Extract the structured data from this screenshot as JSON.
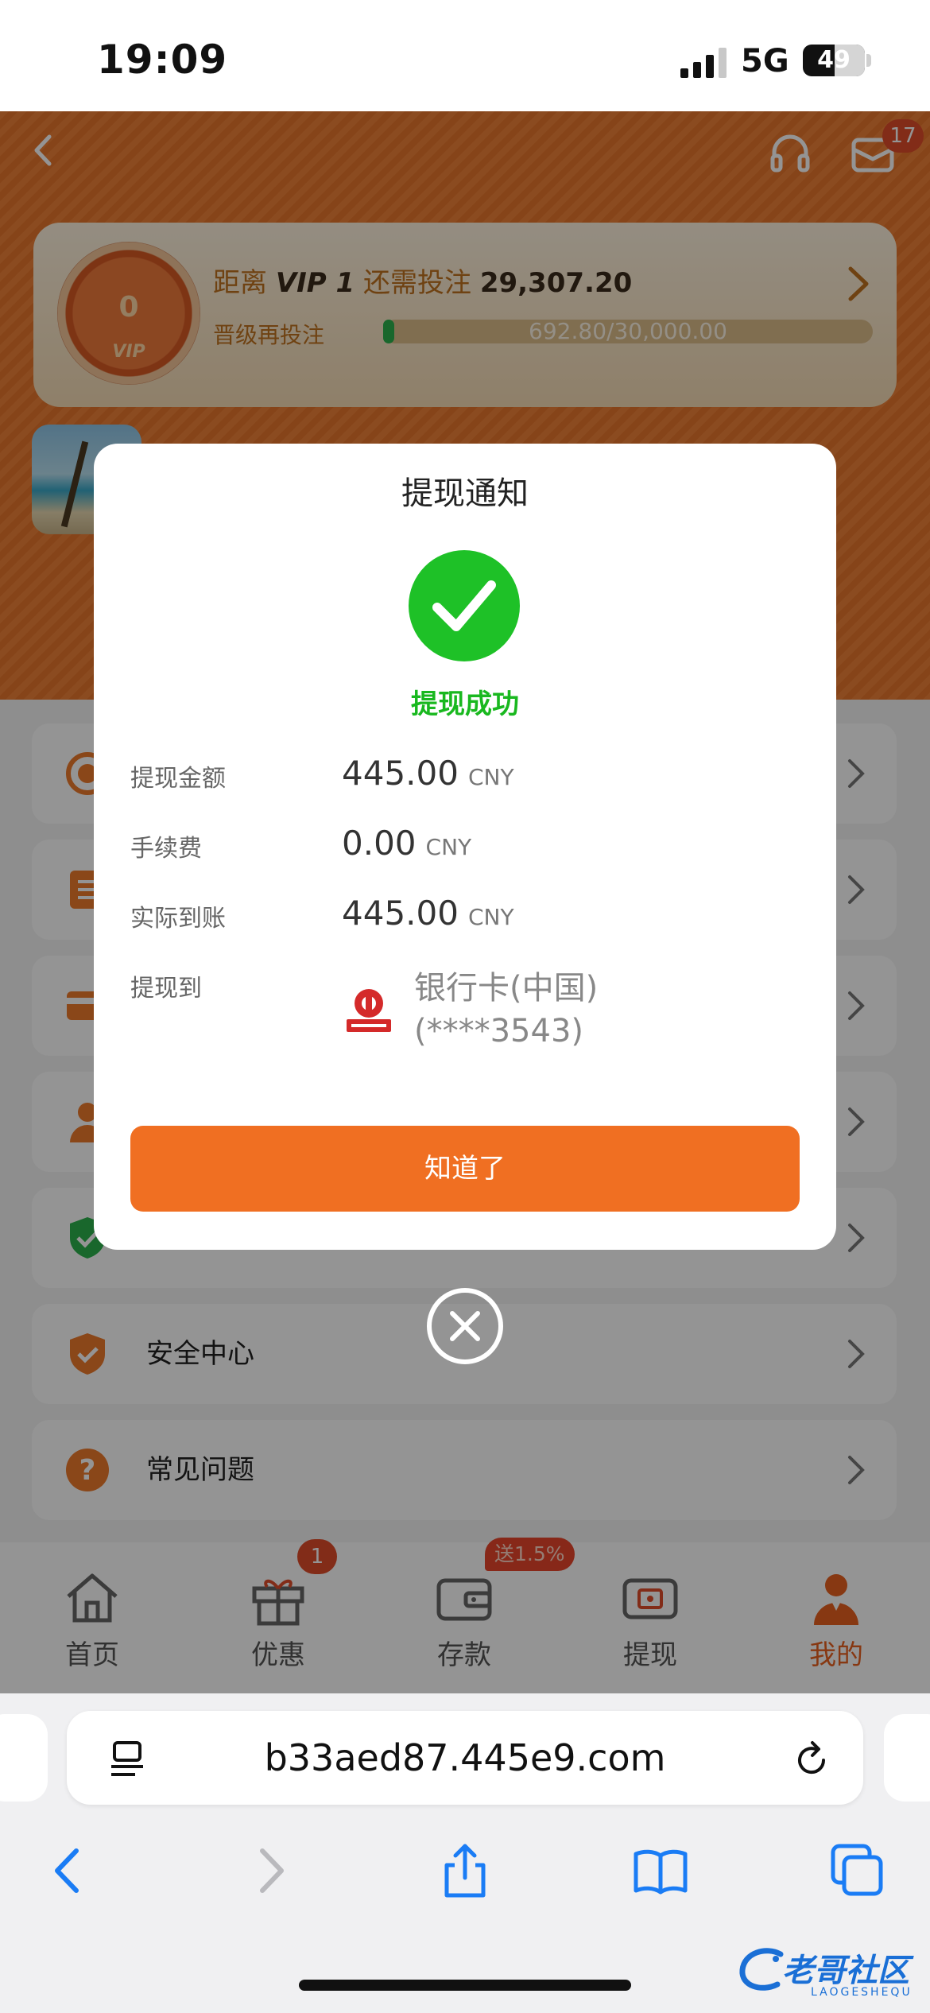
{
  "status_bar": {
    "time": "19:09",
    "network": "5G",
    "battery": "49"
  },
  "header": {
    "message_badge": "17",
    "vip": {
      "medal_level": "0",
      "medal_label": "VIP",
      "prefix": "距离",
      "target": "VIP 1",
      "mid": "还需投注",
      "amount": "29,307.20",
      "progress_label": "晋级再投注",
      "progress_text": "692.80/30,000.00",
      "progress_fraction": 0.0231
    }
  },
  "menu": {
    "items": [
      {
        "label": "",
        "icon": "coins-icon"
      },
      {
        "label": "",
        "icon": "records-icon"
      },
      {
        "label": "",
        "icon": "card-icon"
      },
      {
        "label": "",
        "icon": "user-icon"
      },
      {
        "label": "",
        "icon": "shield-check-icon"
      },
      {
        "label": "安全中心",
        "icon": "shield-icon"
      },
      {
        "label": "常见问题",
        "icon": "question-icon"
      }
    ]
  },
  "tabbar": {
    "tabs": [
      {
        "label": "首页",
        "icon": "home-icon"
      },
      {
        "label": "优惠",
        "icon": "gift-icon",
        "badge": "1"
      },
      {
        "label": "存款",
        "icon": "wallet-icon",
        "promo": "送1.5%"
      },
      {
        "label": "提现",
        "icon": "withdraw-icon"
      },
      {
        "label": "我的",
        "icon": "profile-icon",
        "active": true
      }
    ]
  },
  "dialog": {
    "title": "提现通知",
    "status": "提现成功",
    "rows": [
      {
        "label": "提现金额",
        "value": "445.00",
        "unit": "CNY"
      },
      {
        "label": "手续费",
        "value": "0.00",
        "unit": "CNY"
      },
      {
        "label": "实际到账",
        "value": "445.00",
        "unit": "CNY"
      }
    ],
    "destination_label": "提现到",
    "bank_name": "银行卡(中国)",
    "bank_account": "(****3543)",
    "button": "知道了"
  },
  "browser": {
    "url": "b33aed87.445e9.com"
  },
  "watermark": {
    "text": "老哥社区",
    "sub": "LAOGESHEQU"
  },
  "colors": {
    "brand_orange": "#ee7a2c",
    "button_orange": "#f06f22",
    "success_green": "#1ec127",
    "badge_red": "#e14d2a"
  }
}
